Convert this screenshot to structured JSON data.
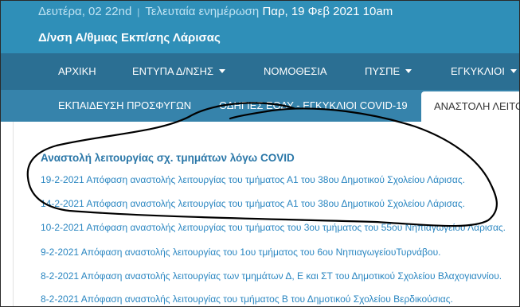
{
  "header": {
    "date": "Δευτέρα, 02 22nd",
    "separator": "|",
    "update_label": "Τελευταία ενημέρωση",
    "update_value": "Παρ, 19 Φεβ 2021 10am",
    "site_title": "Δ/νση Α/θμιας Εκπ/σης Λάρισας"
  },
  "main_nav": [
    {
      "label": "ΑΡΧΙΚΗ",
      "dropdown": false
    },
    {
      "label": "ΕΝΤΥΠΑ Δ/ΝΣΗΣ",
      "dropdown": true
    },
    {
      "label": "ΝΟΜΟΘΕΣΙΑ",
      "dropdown": false
    },
    {
      "label": "ΠΥΣΠΕ",
      "dropdown": true
    },
    {
      "label": "ΕΓΚΥΚΛΙΟΙ",
      "dropdown": true
    }
  ],
  "sub_nav": [
    {
      "label": "ΕΚΠΑΙΔΕΥΣΗ ΠΡΟΣΦΥΓΩΝ"
    },
    {
      "label": "ΟΔΗΓΙΕΣ ΕΟΔΥ - ΕΓΚΥΚΛΙΟΙ COVID-19"
    },
    {
      "label": "ΑΝΑΣΤΟΛΗ ΛΕΙΤΟΥΡΓΙΑΣ",
      "active": true
    }
  ],
  "content": {
    "heading": "Αναστολή λειτουργίας σχ. τμημάτων λόγω COVID",
    "items": [
      "19-2-2021 Απόφαση αναστολής λειτουργίας του τμήματος Α1 του 38ου Δημοτικού Σχολείου Λάρισας.",
      "14-2-2021 Απόφαση αναστολής λειτουργίας του τμήματος Α1 του 38ου Δημοτικού Σχολείου Λάρισας.",
      "10-2-2021 Απόφαση αναστολής λειτουργίας του τμήματος του 3ου τμήματος του 55ου Νηπιαγωγείου Λάρισας.",
      "9-2-2021 Απόφαση αναστολής λειτουργίας του 1ου τμήματος του 6ου ΝηπιαγωγείουΤυρνάβου.",
      "8-2-2021 Απόφαση αναστολής λειτουργίας των τμημάτων Δ, Ε και ΣΤ του Δημοτικού Σχολείου Βλαχογιαννίου.",
      "8-2-2021 Απόφαση αναστολής λειτουργίας του τμήματος Β του Δημοτικού Σχολείου Βερδικούσιας."
    ]
  },
  "annotation": {
    "stroke_color": "#000000"
  }
}
